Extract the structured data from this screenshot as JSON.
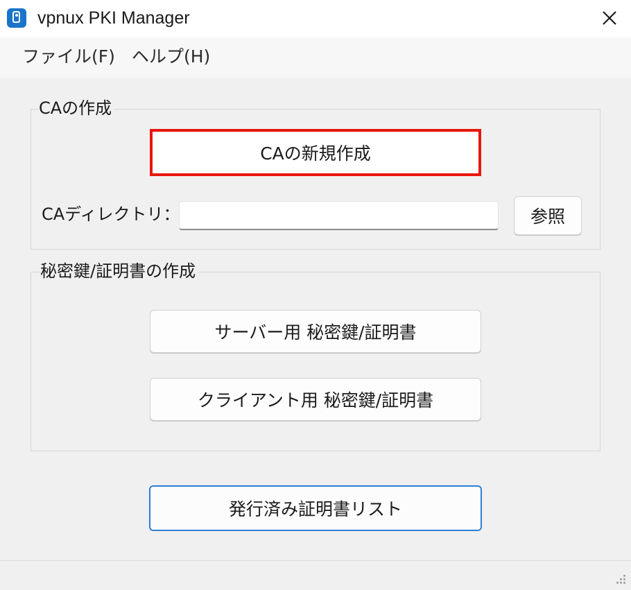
{
  "window": {
    "title": "vpnux PKI Manager",
    "icon": "app-icon",
    "close_icon": "close-icon"
  },
  "menu": {
    "file": "ファイル(F)",
    "help": "ヘルプ(H)"
  },
  "ca_group": {
    "legend": "CAの作成",
    "new_ca_button": "CAの新規作成",
    "dir_label": "CAディレクトリ：",
    "dir_value": "",
    "browse_button": "参照"
  },
  "key_group": {
    "legend": "秘密鍵/証明書の作成",
    "server_button": "サーバー用 秘密鍵/証明書",
    "client_button": "クライアント用 秘密鍵/証明書"
  },
  "issued_list_button": "発行済み証明書リスト",
  "colors": {
    "highlight_border": "#e8160c",
    "focus_border": "#2f7fd6",
    "app_icon": "#1a74c9"
  }
}
